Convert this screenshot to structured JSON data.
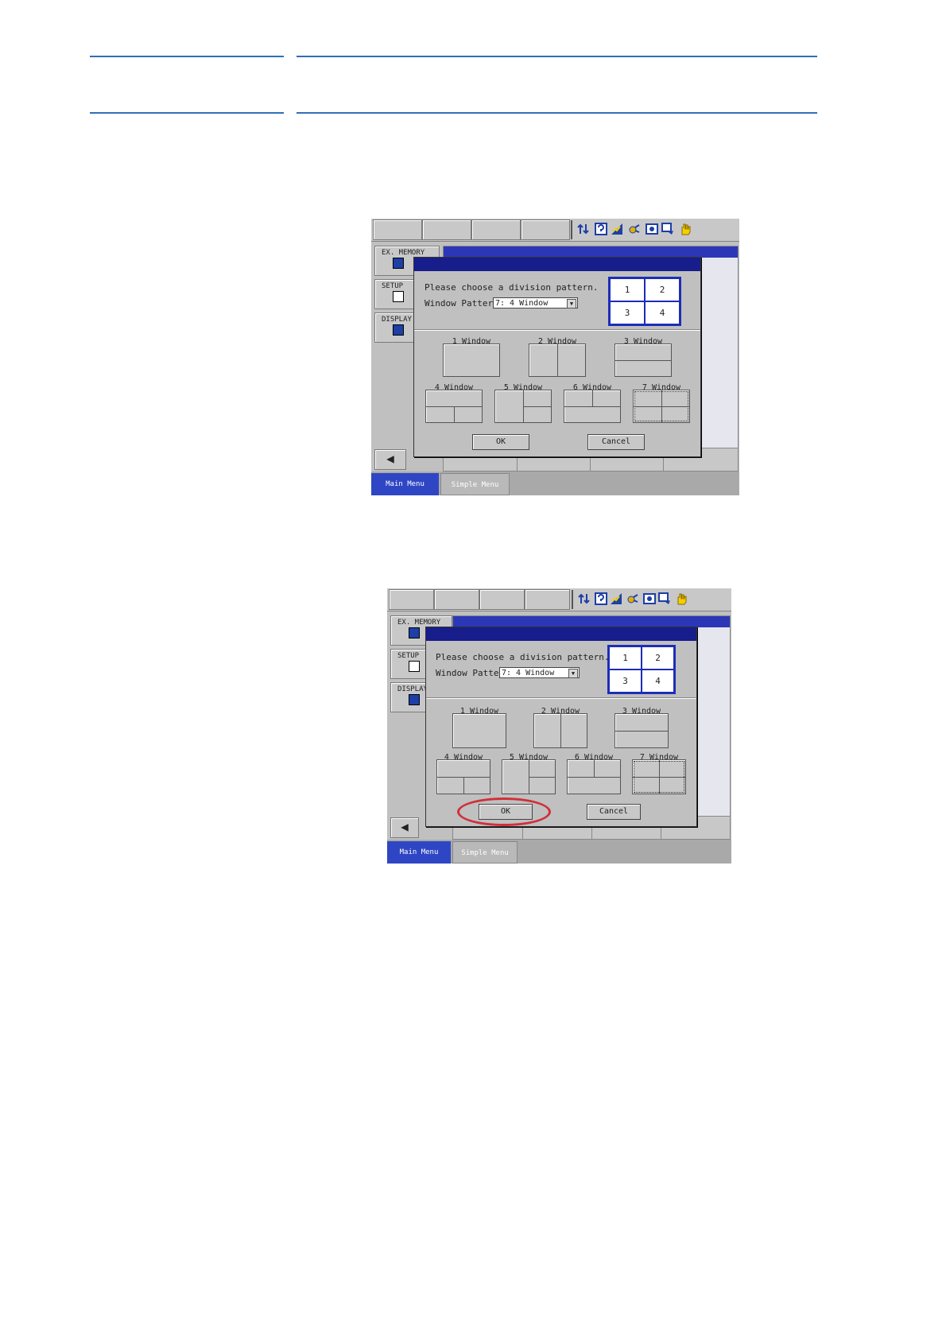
{
  "screens": [
    {
      "left_buttons": [
        "EX. MEMORY",
        "SETUP",
        "DISPLAY"
      ],
      "menu_tabs": {
        "main": "Main Menu",
        "simple": "Simple Menu"
      },
      "dialog": {
        "prompt": "Please choose a division pattern.",
        "pattern_label": "Window Pattern",
        "pattern_value": "7: 4 Window",
        "preview_cells": [
          "1",
          "2",
          "3",
          "4"
        ],
        "options": [
          "1 Window",
          "2 Window",
          "3 Window",
          "4 Window",
          "5 Window",
          "6 Window",
          "7 Window"
        ],
        "ok_label": "OK",
        "cancel_label": "Cancel"
      },
      "ok_highlighted": false
    },
    {
      "left_buttons": [
        "EX. MEMORY",
        "SETUP",
        "DISPLAY"
      ],
      "menu_tabs": {
        "main": "Main Menu",
        "simple": "Simple Menu"
      },
      "dialog": {
        "prompt": "Please choose a division pattern.",
        "pattern_label": "Window Pattern",
        "pattern_value": "7: 4 Window",
        "preview_cells": [
          "1",
          "2",
          "3",
          "4"
        ],
        "options": [
          "1 Window",
          "2 Window",
          "3 Window",
          "4 Window",
          "5 Window",
          "6 Window",
          "7 Window"
        ],
        "ok_label": "OK",
        "cancel_label": "Cancel"
      },
      "ok_highlighted": true
    }
  ],
  "colors": {
    "rule": "#2f6fb6",
    "highlight_circle": "#d0303a",
    "title_bar": "#171d8a",
    "main_tab": "#2f46c4"
  },
  "status_icons": [
    "arrows-icon",
    "help-icon",
    "signal-icon",
    "robot-icon",
    "camera-icon",
    "monitor-icon",
    "hand-icon"
  ]
}
